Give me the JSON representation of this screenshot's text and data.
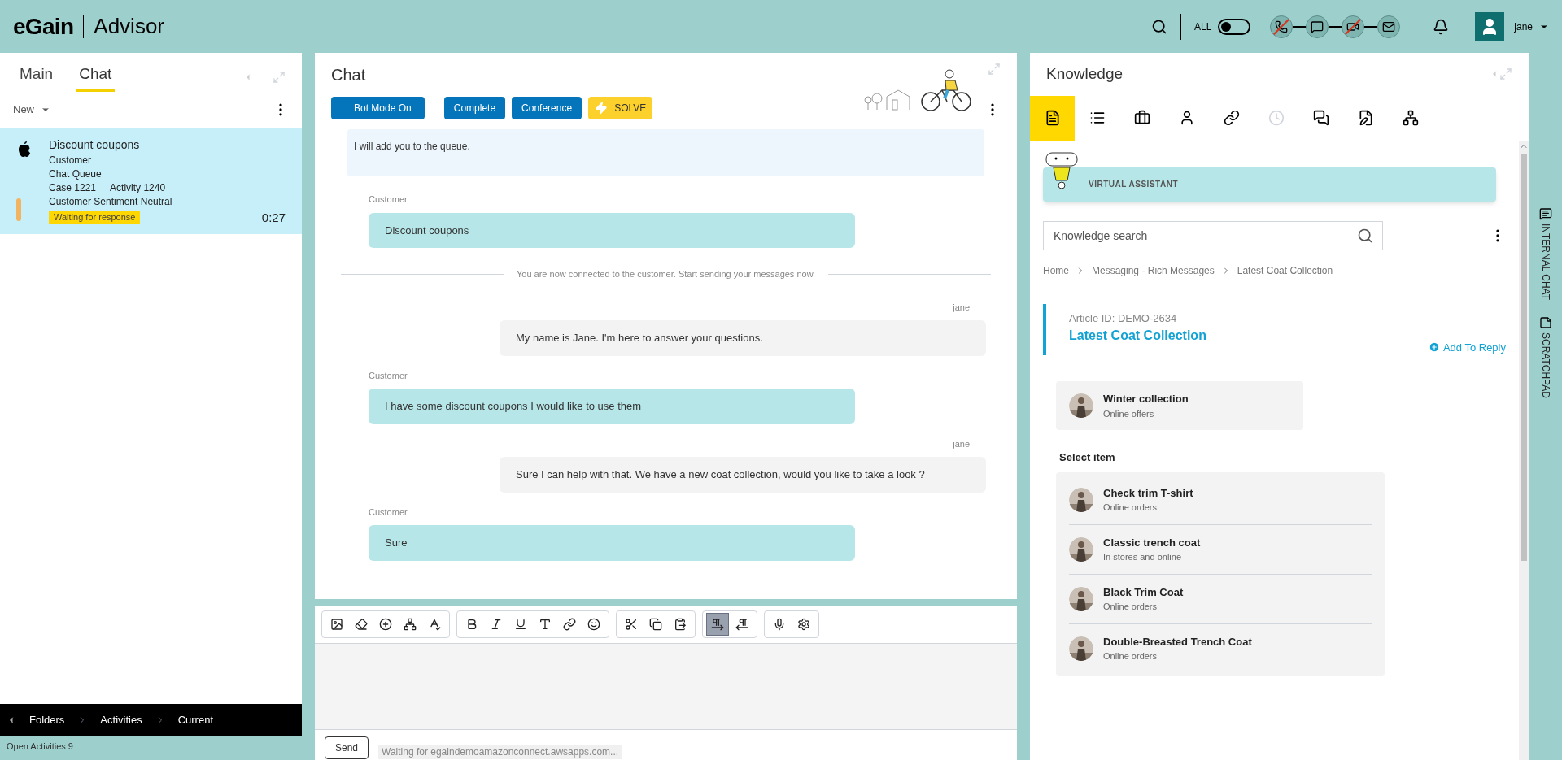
{
  "header": {
    "logo": "eGain",
    "product": "Advisor",
    "filter_label": "ALL",
    "filter_on": false,
    "channels": [
      {
        "kind": "phone",
        "blocked": true
      },
      {
        "kind": "chat",
        "blocked": false
      },
      {
        "kind": "video",
        "blocked": true
      },
      {
        "kind": "email",
        "blocked": false
      }
    ],
    "user": "jane"
  },
  "left_panel": {
    "tabs": [
      {
        "label": "Main",
        "selected": false
      },
      {
        "label": "Chat",
        "selected": true
      }
    ],
    "new_menu": "New",
    "activities": [
      {
        "title": "Discount coupons",
        "lines": [
          "Customer",
          "Chat Queue"
        ],
        "case": "Case 1221",
        "activity": "Activity 1240",
        "sentiment": "Customer Sentiment Neutral",
        "status": "Waiting for response",
        "timer": "0:27",
        "selected": true
      }
    ],
    "breadcrumb": [
      "Folders",
      "Activities",
      "Current"
    ],
    "status": "Open Activities 9"
  },
  "chat": {
    "title": "Chat",
    "buttons": [
      {
        "label": "Bot Mode On",
        "kind": "primary"
      },
      {
        "label": "Complete",
        "kind": "primary"
      },
      {
        "label": "Conference",
        "kind": "primary"
      },
      {
        "label": "SOLVE",
        "kind": "solve"
      }
    ],
    "messages": [
      {
        "kind": "bot",
        "text": "I will add you to the queue."
      },
      {
        "kind": "customer",
        "sender": "Customer",
        "text": "Discount coupons"
      },
      {
        "kind": "notice",
        "text": "You are now connected to the customer. Start sending your messages now."
      },
      {
        "kind": "agent",
        "sender": "jane",
        "text": "My name is Jane. I'm here to answer your questions."
      },
      {
        "kind": "customer",
        "sender": "Customer",
        "text": "I have some discount coupons I would like to use them"
      },
      {
        "kind": "agent",
        "sender": "jane",
        "text": "Sure I can help with that. We have a new coat collection, would you like to take a look ?"
      },
      {
        "kind": "customer",
        "sender": "Customer",
        "text": "Sure"
      }
    ],
    "editor_tools": [
      {
        "kind": "ltr",
        "selected": true
      },
      {
        "kind": "rtl",
        "selected": false
      }
    ],
    "send": "Send",
    "browser_status": "Waiting for egaindemoamazonconnect.awsapps.com..."
  },
  "knowledge": {
    "title": "Knowledge",
    "tools": [
      {
        "kind": "article",
        "selected": true
      },
      {
        "kind": "list",
        "selected": false
      },
      {
        "kind": "case",
        "selected": false
      },
      {
        "kind": "person",
        "selected": false
      },
      {
        "kind": "link",
        "selected": false
      },
      {
        "kind": "history",
        "selected": false
      },
      {
        "kind": "chat",
        "selected": false
      },
      {
        "kind": "edit",
        "selected": false
      },
      {
        "kind": "diagram",
        "selected": false
      }
    ],
    "assistant": "VIRTUAL ASSISTANT",
    "search": {
      "placeholder": "Knowledge search"
    },
    "breadcrumb": [
      "Home",
      "Messaging - Rich Messages",
      "Latest Coat Collection"
    ],
    "article_id": "Article ID: DEMO-2634",
    "article_title": "Latest Coat Collection",
    "add_to_reply": "Add To Reply",
    "card": {
      "title": "Winter collection",
      "subtitle": "Online offers"
    },
    "select_label": "Select item",
    "items": [
      {
        "title": "Check trim T-shirt",
        "subtitle": "Online orders"
      },
      {
        "title": "Classic trench coat",
        "subtitle": "In stores and online"
      },
      {
        "title": "Black Trim Coat",
        "subtitle": "Online orders"
      },
      {
        "title": "Double-Breasted Trench Coat",
        "subtitle": "Online orders"
      }
    ]
  },
  "rail": [
    "INTERNAL CHAT",
    "SCRATCHPAD"
  ]
}
